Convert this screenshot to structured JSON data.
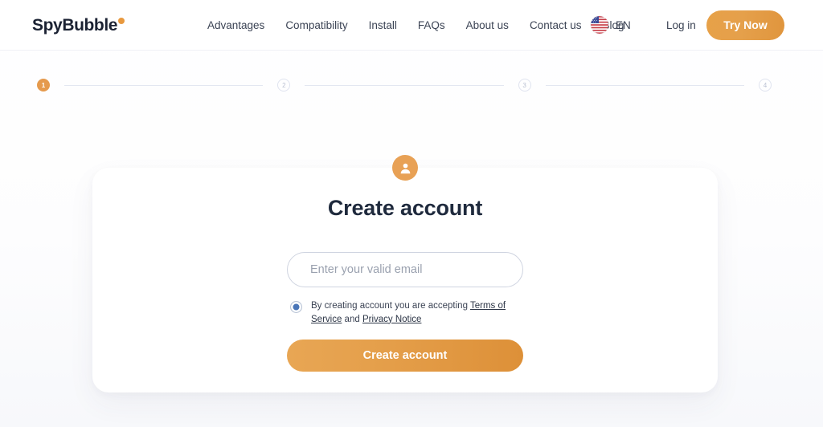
{
  "header": {
    "logo": {
      "text": "SpyBubble",
      "dot_color": "#e8993f"
    },
    "nav": [
      {
        "label": "Advantages"
      },
      {
        "label": "Compatibility"
      },
      {
        "label": "Install"
      },
      {
        "label": "FAQs"
      },
      {
        "label": "About us"
      },
      {
        "label": "Contact us"
      },
      {
        "label": "Blog"
      }
    ],
    "language": {
      "code": "EN",
      "flag": "us-flag-icon"
    },
    "login_label": "Log in",
    "cta_label": "Try Now",
    "cta_color": "#e5a04b"
  },
  "stepper": {
    "active_index": 1,
    "steps": [
      {
        "number": "1",
        "state": "active"
      },
      {
        "number": "2",
        "state": "idle"
      },
      {
        "number": "3",
        "state": "idle"
      },
      {
        "number": "4",
        "state": "idle"
      }
    ]
  },
  "card": {
    "avatar_icon": "user-avatar-icon",
    "title": "Create account",
    "email": {
      "value": "",
      "placeholder": "Enter your valid email"
    },
    "terms": {
      "accepted": true,
      "prefix": "By creating account you are accepting ",
      "link_terms": "Terms of Service",
      "conjunction": " and ",
      "link_privacy": "Privacy Notice"
    },
    "submit_label": "Create account",
    "submit_color": "#e5a04c"
  }
}
